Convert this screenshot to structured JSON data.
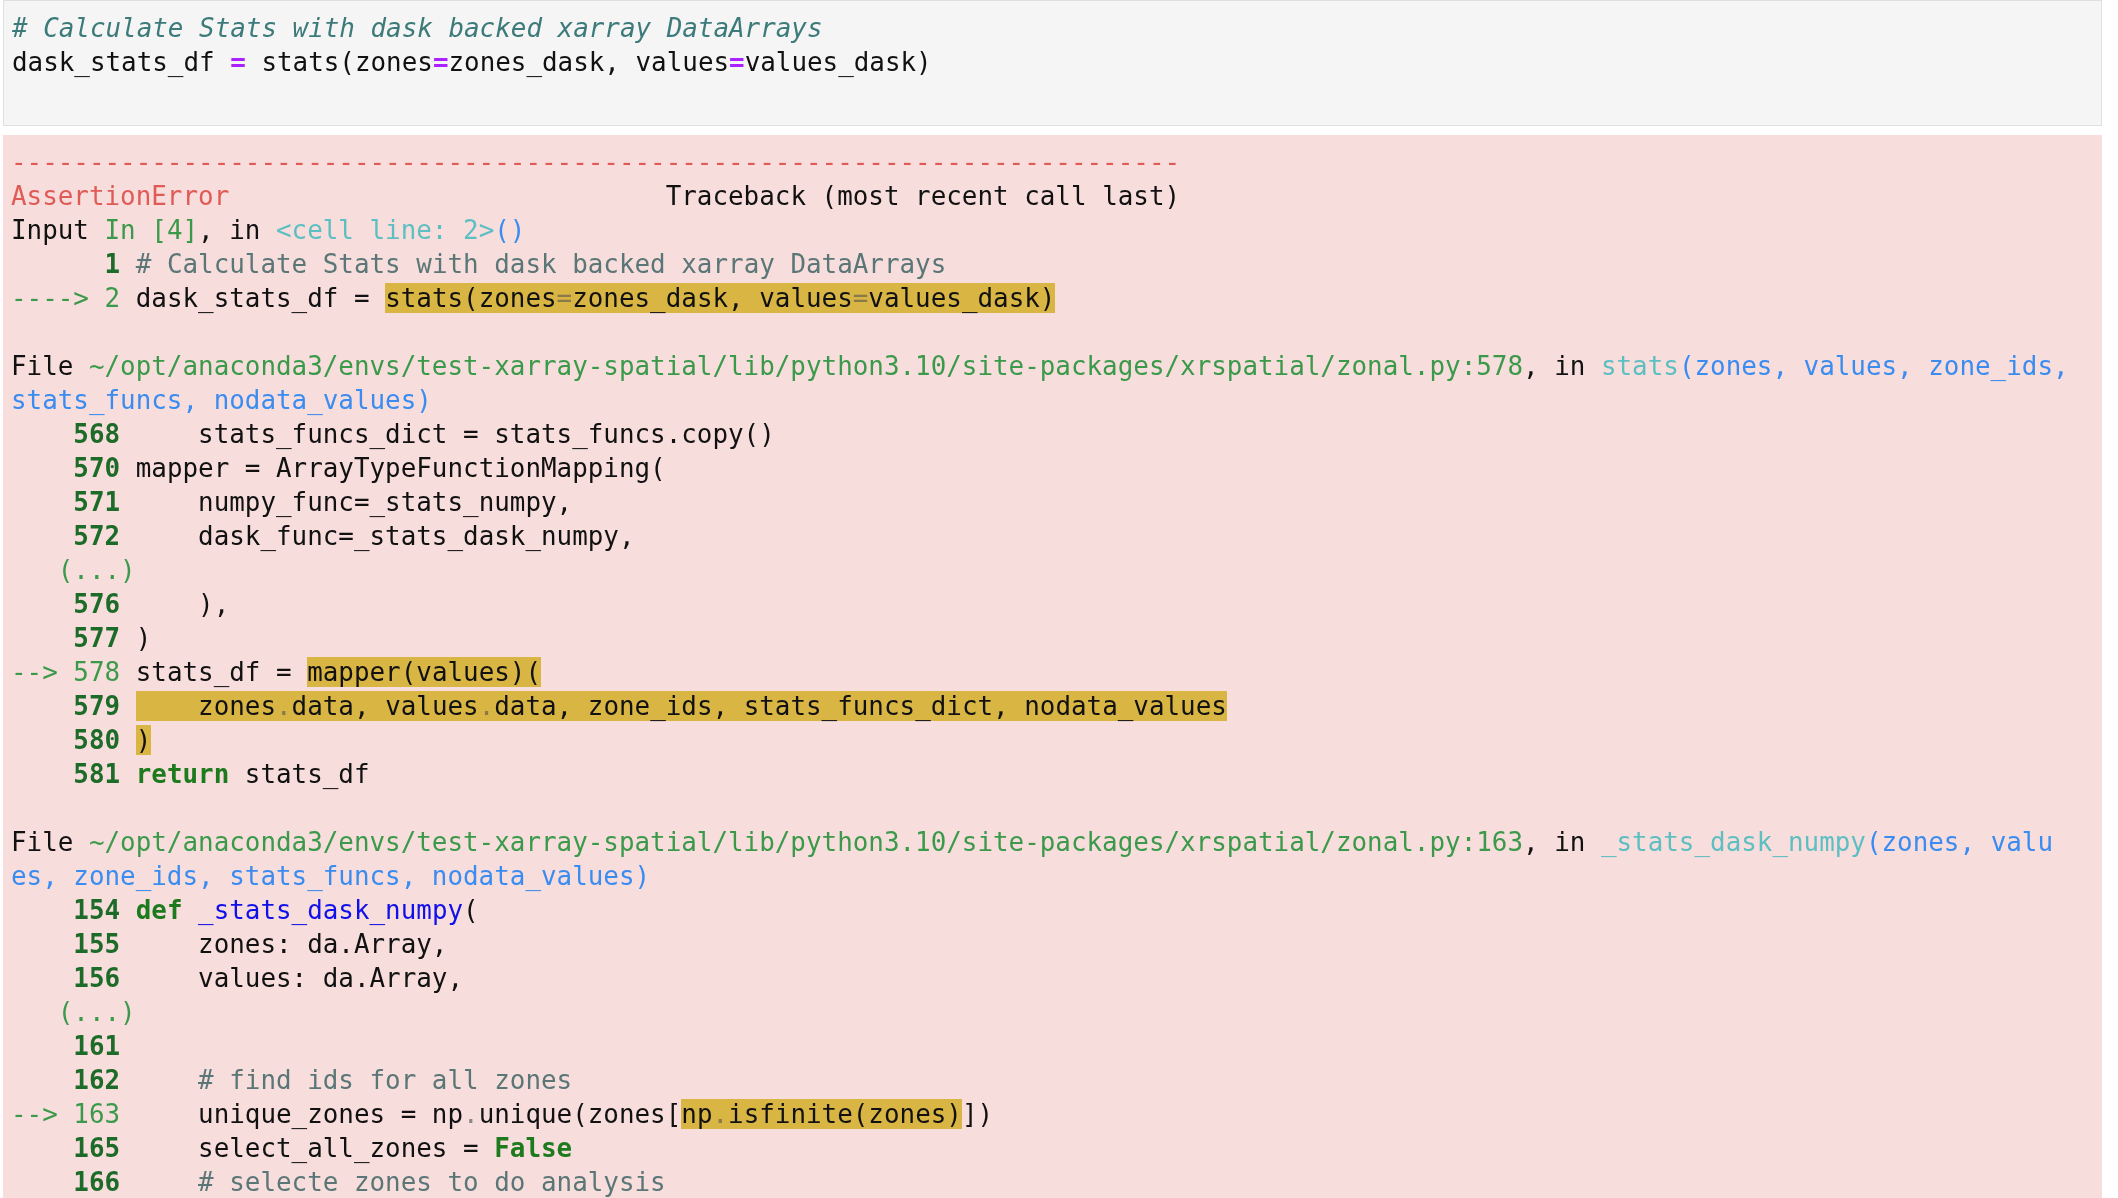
{
  "input_cell": {
    "lines": [
      [
        {
          "text": "# Calculate Stats with dask backed xarray DataArrays",
          "kind": "input-comment"
        }
      ],
      [
        {
          "text": "dask_stats_df ",
          "kind": "plain"
        },
        {
          "text": "=",
          "kind": "operator"
        },
        {
          "text": " stats(zones",
          "kind": "plain"
        },
        {
          "text": "=",
          "kind": "operator"
        },
        {
          "text": "zones_dask, values",
          "kind": "plain"
        },
        {
          "text": "=",
          "kind": "operator"
        },
        {
          "text": "values_dask)",
          "kind": "plain"
        }
      ]
    ]
  },
  "error_output": {
    "lines": [
      {
        "kind": "code",
        "segments": [
          {
            "text": "---------------------------------------------------------------------------",
            "kind": "red"
          }
        ]
      },
      {
        "kind": "code",
        "segments": [
          {
            "text": "AssertionError",
            "kind": "red"
          },
          {
            "text": "                            Traceback (most recent call last)",
            "kind": "plain"
          }
        ]
      },
      {
        "kind": "code",
        "segments": [
          {
            "text": "Input ",
            "kind": "plain"
          },
          {
            "text": "In [4]",
            "kind": "green"
          },
          {
            "text": ", in ",
            "kind": "plain"
          },
          {
            "text": "<cell line: 2>",
            "kind": "cyan"
          },
          {
            "text": "()",
            "kind": "blue"
          }
        ]
      },
      {
        "kind": "code",
        "segments": [
          {
            "text": "      1 ",
            "kind": "lineno"
          },
          {
            "text": "# Calculate Stats with dask backed xarray DataArrays",
            "kind": "comment"
          }
        ]
      },
      {
        "kind": "code",
        "segments": [
          {
            "text": "----> 2",
            "kind": "green"
          },
          {
            "text": " dask_stats_df = ",
            "kind": "plain"
          },
          {
            "text": "stats(zones",
            "kind": "hl"
          },
          {
            "text": "=",
            "kind": "hl-dim"
          },
          {
            "text": "zones_dask, values",
            "kind": "hl"
          },
          {
            "text": "=",
            "kind": "hl-dim"
          },
          {
            "text": "values_dask)",
            "kind": "hl"
          }
        ]
      },
      {
        "kind": "blank"
      },
      {
        "kind": "code",
        "segments": [
          {
            "text": "File ",
            "kind": "plain"
          },
          {
            "text": "~/opt/anaconda3/envs/test-xarray-spatial/lib/python3.10/site-packages/xrspatial/zonal.py:578",
            "kind": "green"
          },
          {
            "text": ", in ",
            "kind": "plain"
          },
          {
            "text": "stats",
            "kind": "cyan"
          },
          {
            "text": "(zones, values, zone_ids, stats_funcs, nodata_values)",
            "kind": "blue"
          }
        ]
      },
      {
        "kind": "code",
        "segments": [
          {
            "text": "    568",
            "kind": "lineno"
          },
          {
            "text": "     stats_funcs_dict = stats_funcs.copy()",
            "kind": "plain"
          }
        ]
      },
      {
        "kind": "code",
        "segments": [
          {
            "text": "    570",
            "kind": "lineno"
          },
          {
            "text": " mapper = ArrayTypeFunctionMapping(",
            "kind": "plain"
          }
        ]
      },
      {
        "kind": "code",
        "segments": [
          {
            "text": "    571",
            "kind": "lineno"
          },
          {
            "text": "     numpy_func=_stats_numpy,",
            "kind": "plain"
          }
        ]
      },
      {
        "kind": "code",
        "segments": [
          {
            "text": "    572",
            "kind": "lineno"
          },
          {
            "text": "     dask_func=_stats_dask_numpy,",
            "kind": "plain"
          }
        ]
      },
      {
        "kind": "code",
        "segments": [
          {
            "text": "   (...)",
            "kind": "green"
          }
        ]
      },
      {
        "kind": "code",
        "segments": [
          {
            "text": "    576",
            "kind": "lineno"
          },
          {
            "text": "     ),",
            "kind": "plain"
          }
        ]
      },
      {
        "kind": "code",
        "segments": [
          {
            "text": "    577",
            "kind": "lineno"
          },
          {
            "text": " )",
            "kind": "plain"
          }
        ]
      },
      {
        "kind": "code",
        "segments": [
          {
            "text": "--> 578",
            "kind": "green"
          },
          {
            "text": " stats_df = ",
            "kind": "plain"
          },
          {
            "text": "mapper(values)(",
            "kind": "hl"
          }
        ]
      },
      {
        "kind": "code",
        "segments": [
          {
            "text": "    579 ",
            "kind": "lineno"
          },
          {
            "text": "    zones",
            "kind": "hl"
          },
          {
            "text": ".",
            "kind": "hl-dim"
          },
          {
            "text": "data, values",
            "kind": "hl"
          },
          {
            "text": ".",
            "kind": "hl-dim"
          },
          {
            "text": "data, zone_ids, stats_funcs_dict, nodata_values",
            "kind": "hl"
          }
        ]
      },
      {
        "kind": "code",
        "segments": [
          {
            "text": "    580 ",
            "kind": "lineno"
          },
          {
            "text": ")",
            "kind": "hl"
          }
        ]
      },
      {
        "kind": "code",
        "segments": [
          {
            "text": "    581 ",
            "kind": "lineno"
          },
          {
            "text": "return",
            "kind": "keyword"
          },
          {
            "text": " stats_df",
            "kind": "plain"
          }
        ]
      },
      {
        "kind": "blank"
      },
      {
        "kind": "code",
        "segments": [
          {
            "text": "File ",
            "kind": "plain"
          },
          {
            "text": "~/opt/anaconda3/envs/test-xarray-spatial/lib/python3.10/site-packages/xrspatial/zonal.py:163",
            "kind": "green"
          },
          {
            "text": ", in ",
            "kind": "plain"
          },
          {
            "text": "_stats_dask_numpy",
            "kind": "cyan"
          },
          {
            "text": "(zones, values, zone_ids, stats_funcs, nodata_values)",
            "kind": "blue"
          }
        ]
      },
      {
        "kind": "code",
        "segments": [
          {
            "text": "    154 ",
            "kind": "lineno"
          },
          {
            "text": "def",
            "kind": "keyword"
          },
          {
            "text": " _stats_dask_numpy",
            "kind": "funcname"
          },
          {
            "text": "(",
            "kind": "plain"
          }
        ]
      },
      {
        "kind": "code",
        "segments": [
          {
            "text": "    155",
            "kind": "lineno"
          },
          {
            "text": "     zones: da.Array,",
            "kind": "plain"
          }
        ]
      },
      {
        "kind": "code",
        "segments": [
          {
            "text": "    156",
            "kind": "lineno"
          },
          {
            "text": "     values: da.Array,",
            "kind": "plain"
          }
        ]
      },
      {
        "kind": "code",
        "segments": [
          {
            "text": "   (...)",
            "kind": "green"
          }
        ]
      },
      {
        "kind": "code",
        "segments": [
          {
            "text": "    161",
            "kind": "lineno"
          }
        ]
      },
      {
        "kind": "code",
        "segments": [
          {
            "text": "    162",
            "kind": "lineno"
          },
          {
            "text": "     # find ids for all zones",
            "kind": "comment"
          }
        ]
      },
      {
        "kind": "code",
        "segments": [
          {
            "text": "--> 163",
            "kind": "green"
          },
          {
            "text": "     unique_zones = np",
            "kind": "plain"
          },
          {
            "text": ".",
            "kind": "dim"
          },
          {
            "text": "unique(zones[",
            "kind": "plain"
          },
          {
            "text": "np",
            "kind": "hl"
          },
          {
            "text": ".",
            "kind": "hl-dim"
          },
          {
            "text": "isfinite(zones)",
            "kind": "hl"
          },
          {
            "text": "])",
            "kind": "plain"
          }
        ]
      },
      {
        "kind": "code",
        "segments": [
          {
            "text": "    165",
            "kind": "lineno"
          },
          {
            "text": "     select_all_zones = ",
            "kind": "plain"
          },
          {
            "text": "False",
            "kind": "keyword"
          }
        ]
      },
      {
        "kind": "code",
        "segments": [
          {
            "text": "    166",
            "kind": "lineno"
          },
          {
            "text": "     # selecte zones to do analysis",
            "kind": "comment"
          }
        ]
      }
    ]
  }
}
